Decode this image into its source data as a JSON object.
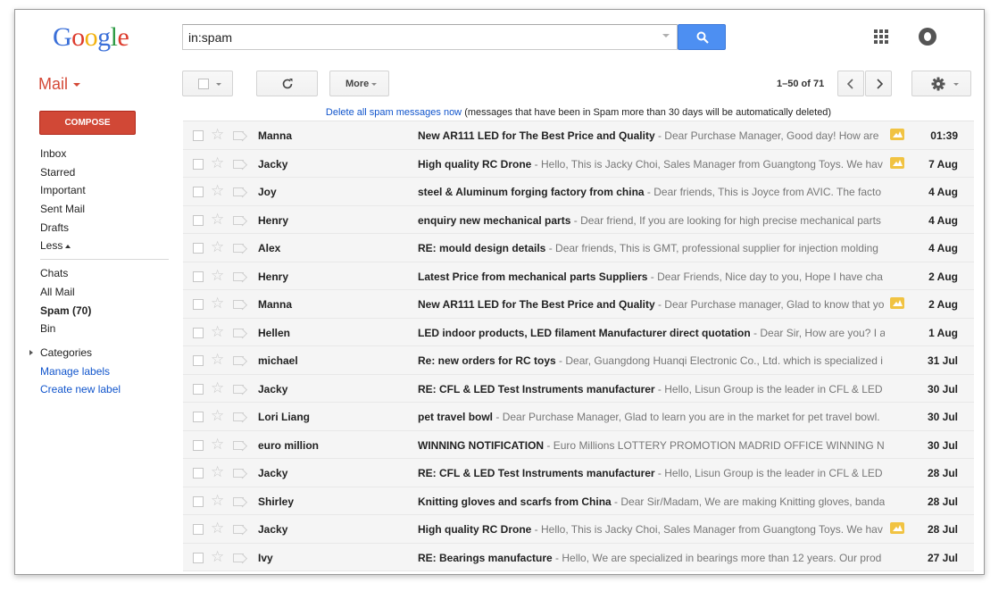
{
  "logo": {
    "text": "Google"
  },
  "search": {
    "value": "in:spam"
  },
  "toolbar": {
    "mail_label": "Mail",
    "more_label": "More",
    "pager_text": "1–50 of 71"
  },
  "sidebar": {
    "compose_label": "COMPOSE",
    "items": [
      {
        "label": "Inbox"
      },
      {
        "label": "Starred"
      },
      {
        "label": "Important"
      },
      {
        "label": "Sent Mail"
      },
      {
        "label": "Drafts"
      },
      {
        "label": "Less"
      }
    ],
    "items2": [
      {
        "label": "Chats"
      },
      {
        "label": "All Mail"
      },
      {
        "label": "Spam (70)"
      },
      {
        "label": "Bin"
      },
      {
        "label": "Categories"
      },
      {
        "label": "Manage labels"
      },
      {
        "label": "Create new label"
      }
    ]
  },
  "banner": {
    "link_text": "Delete all spam messages now",
    "note": " (messages that have been in Spam more than 30 days will be automatically deleted)"
  },
  "messages": [
    {
      "sender": "Manna",
      "subject": "New AR111 LED for The Best Price and Quality",
      "snippet": " - Dear Purchase Manager, Good day! How are",
      "attachment": true,
      "date": "01:39"
    },
    {
      "sender": "Jacky",
      "subject": "High quality RC Drone",
      "snippet": " - Hello, This is Jacky Choi, Sales Manager from Guangtong Toys. We hav",
      "attachment": true,
      "date": "7 Aug"
    },
    {
      "sender": "Joy",
      "subject": "steel & Aluminum forging factory from china",
      "snippet": " - Dear friends, This is Joyce from AVIC. The facto",
      "attachment": false,
      "date": "4 Aug"
    },
    {
      "sender": "Henry",
      "subject": "enquiry new mechanical parts",
      "snippet": " - Dear friend, If you are looking for high precise mechanical parts",
      "attachment": false,
      "date": "4 Aug"
    },
    {
      "sender": "Alex",
      "subject": "RE: mould design details",
      "snippet": " - Dear friends, This is GMT, professional supplier for injection molding",
      "attachment": false,
      "date": "4 Aug"
    },
    {
      "sender": "Henry",
      "subject": "Latest Price from mechanical parts Suppliers",
      "snippet": " - Dear Friends, Nice day to you, Hope I have cha",
      "attachment": false,
      "date": "2 Aug"
    },
    {
      "sender": "Manna",
      "subject": "New AR111 LED for The Best Price and Quality",
      "snippet": " - Dear Purchase manager, Glad to know that yo",
      "attachment": true,
      "date": "2 Aug"
    },
    {
      "sender": "Hellen",
      "subject": "LED indoor products, LED filament Manufacturer direct quotation",
      "snippet": " - Dear Sir, How are you? I a",
      "attachment": false,
      "date": "1 Aug"
    },
    {
      "sender": "michael",
      "subject": "Re: new orders for RC toys",
      "snippet": " - Dear, Guangdong Huanqi Electronic Co., Ltd. which is specialized i",
      "attachment": false,
      "date": "31 Jul"
    },
    {
      "sender": "Jacky",
      "subject": "RE: CFL & LED Test Instruments manufacturer",
      "snippet": " - Hello, Lisun Group is the leader in CFL & LED",
      "attachment": false,
      "date": "30 Jul"
    },
    {
      "sender": "Lori Liang",
      "subject": "pet travel bowl",
      "snippet": " - Dear Purchase Manager, Glad to learn you are in the market for pet travel bowl.",
      "attachment": false,
      "date": "30 Jul"
    },
    {
      "sender": "euro million",
      "subject": "WINNING NOTIFICATION",
      "snippet": " - Euro Millions LOTTERY PROMOTION MADRID OFFICE WINNING N",
      "attachment": false,
      "date": "30 Jul"
    },
    {
      "sender": "Jacky",
      "subject": "RE: CFL & LED Test Instruments manufacturer",
      "snippet": " - Hello, Lisun Group is the leader in CFL & LED",
      "attachment": false,
      "date": "28 Jul"
    },
    {
      "sender": "Shirley",
      "subject": "Knitting gloves and scarfs from China",
      "snippet": " - Dear Sir/Madam, We are making Knitting gloves, banda",
      "attachment": false,
      "date": "28 Jul"
    },
    {
      "sender": "Jacky",
      "subject": "High quality RC Drone",
      "snippet": " - Hello, This is Jacky Choi, Sales Manager from Guangtong Toys. We hav",
      "attachment": true,
      "date": "28 Jul"
    },
    {
      "sender": "Ivy",
      "subject": "RE: Bearings manufacture",
      "snippet": " - Hello, We are specialized in bearings more than 12 years. Our prod",
      "attachment": false,
      "date": "27 Jul"
    }
  ]
}
